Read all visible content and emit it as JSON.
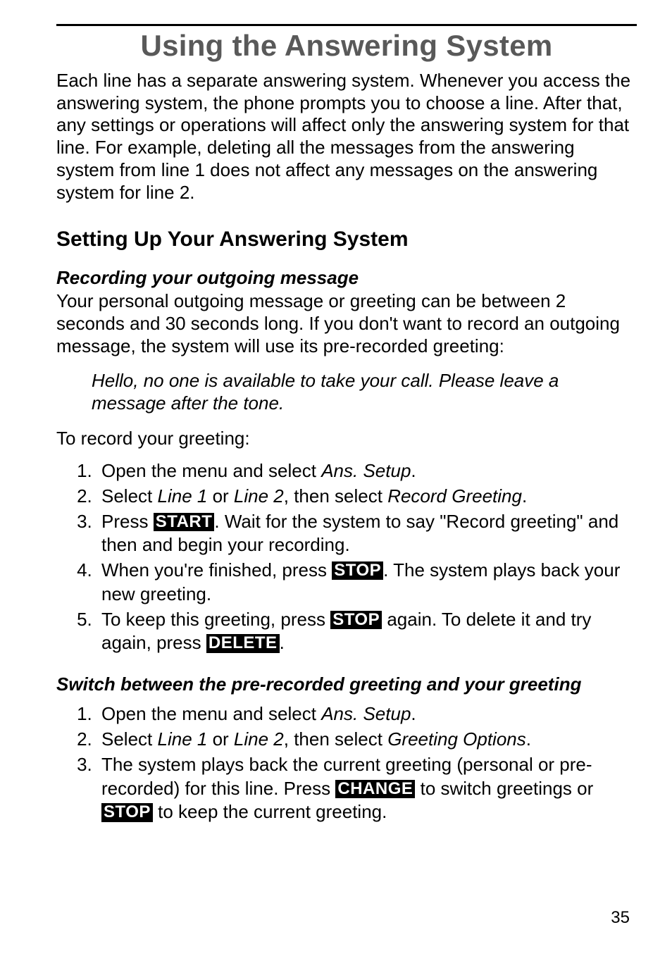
{
  "title": "Using the Answering System",
  "intro": "Each line has a separate answering system. Whenever you access the answering system, the phone prompts you to choose a line. After that, any settings or operations will affect only the answering system for that line. For example, deleting all the messages from the answering system from line 1 does not affect any messages on the answering system for line 2.",
  "section1": {
    "heading": "Setting Up Your Answering System",
    "sub1": {
      "heading": "Recording your outgoing message",
      "body": "Your personal outgoing message or greeting can be between 2 seconds and 30 seconds long. If you don't want to record an outgoing message, the system will use its pre-recorded greeting:",
      "quote": "Hello, no one is available to take your call. Please leave a message after the tone.",
      "lead": "To record your greeting:",
      "steps": {
        "s1_a": "Open the menu and select ",
        "s1_ans": "Ans. Setup",
        "s1_b": ".",
        "s2_a": "Select ",
        "s2_l1": "Line 1",
        "s2_b": " or ",
        "s2_l2": "Line 2",
        "s2_c": ", then select ",
        "s2_rg": "Record Greeting",
        "s2_d": ".",
        "s3_a": "Press ",
        "s3_key": "START",
        "s3_b": ". Wait for the system to say \"Record greeting\" and then and begin your recording.",
        "s4_a": "When you're finished, press ",
        "s4_key": "STOP",
        "s4_b": ". The system plays back your new greeting.",
        "s5_a": "To keep this greeting, press ",
        "s5_key1": "STOP",
        "s5_b": " again. To delete it and try again, press ",
        "s5_key2": "DELETE",
        "s5_c": "."
      }
    },
    "sub2": {
      "heading": "Switch between the pre-recorded greeting and your greeting",
      "steps": {
        "s1_a": "Open the menu and select ",
        "s1_ans": "Ans. Setup",
        "s1_b": ".",
        "s2_a": "Select ",
        "s2_l1": "Line 1",
        "s2_b": " or ",
        "s2_l2": "Line 2",
        "s2_c": ", then select ",
        "s2_go": "Greeting Options",
        "s2_d": ".",
        "s3_a": "The system plays back the current greeting (personal or pre-recorded) for this line. Press ",
        "s3_key1": "CHANGE",
        "s3_b": " to switch greetings or ",
        "s3_key2": "STOP",
        "s3_c": " to keep the current greeting."
      }
    }
  },
  "pagenum": "35"
}
